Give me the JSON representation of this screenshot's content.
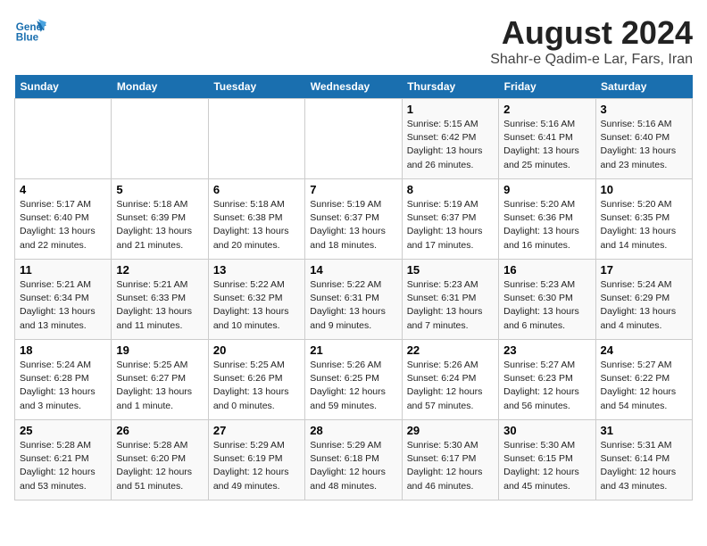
{
  "header": {
    "logo_line1": "General",
    "logo_line2": "Blue",
    "main_title": "August 2024",
    "subtitle": "Shahr-e Qadim-e Lar, Fars, Iran"
  },
  "weekdays": [
    "Sunday",
    "Monday",
    "Tuesday",
    "Wednesday",
    "Thursday",
    "Friday",
    "Saturday"
  ],
  "weeks": [
    [
      {
        "day": "",
        "info": ""
      },
      {
        "day": "",
        "info": ""
      },
      {
        "day": "",
        "info": ""
      },
      {
        "day": "",
        "info": ""
      },
      {
        "day": "1",
        "info": "Sunrise: 5:15 AM\nSunset: 6:42 PM\nDaylight: 13 hours and 26 minutes."
      },
      {
        "day": "2",
        "info": "Sunrise: 5:16 AM\nSunset: 6:41 PM\nDaylight: 13 hours and 25 minutes."
      },
      {
        "day": "3",
        "info": "Sunrise: 5:16 AM\nSunset: 6:40 PM\nDaylight: 13 hours and 23 minutes."
      }
    ],
    [
      {
        "day": "4",
        "info": "Sunrise: 5:17 AM\nSunset: 6:40 PM\nDaylight: 13 hours and 22 minutes."
      },
      {
        "day": "5",
        "info": "Sunrise: 5:18 AM\nSunset: 6:39 PM\nDaylight: 13 hours and 21 minutes."
      },
      {
        "day": "6",
        "info": "Sunrise: 5:18 AM\nSunset: 6:38 PM\nDaylight: 13 hours and 20 minutes."
      },
      {
        "day": "7",
        "info": "Sunrise: 5:19 AM\nSunset: 6:37 PM\nDaylight: 13 hours and 18 minutes."
      },
      {
        "day": "8",
        "info": "Sunrise: 5:19 AM\nSunset: 6:37 PM\nDaylight: 13 hours and 17 minutes."
      },
      {
        "day": "9",
        "info": "Sunrise: 5:20 AM\nSunset: 6:36 PM\nDaylight: 13 hours and 16 minutes."
      },
      {
        "day": "10",
        "info": "Sunrise: 5:20 AM\nSunset: 6:35 PM\nDaylight: 13 hours and 14 minutes."
      }
    ],
    [
      {
        "day": "11",
        "info": "Sunrise: 5:21 AM\nSunset: 6:34 PM\nDaylight: 13 hours and 13 minutes."
      },
      {
        "day": "12",
        "info": "Sunrise: 5:21 AM\nSunset: 6:33 PM\nDaylight: 13 hours and 11 minutes."
      },
      {
        "day": "13",
        "info": "Sunrise: 5:22 AM\nSunset: 6:32 PM\nDaylight: 13 hours and 10 minutes."
      },
      {
        "day": "14",
        "info": "Sunrise: 5:22 AM\nSunset: 6:31 PM\nDaylight: 13 hours and 9 minutes."
      },
      {
        "day": "15",
        "info": "Sunrise: 5:23 AM\nSunset: 6:31 PM\nDaylight: 13 hours and 7 minutes."
      },
      {
        "day": "16",
        "info": "Sunrise: 5:23 AM\nSunset: 6:30 PM\nDaylight: 13 hours and 6 minutes."
      },
      {
        "day": "17",
        "info": "Sunrise: 5:24 AM\nSunset: 6:29 PM\nDaylight: 13 hours and 4 minutes."
      }
    ],
    [
      {
        "day": "18",
        "info": "Sunrise: 5:24 AM\nSunset: 6:28 PM\nDaylight: 13 hours and 3 minutes."
      },
      {
        "day": "19",
        "info": "Sunrise: 5:25 AM\nSunset: 6:27 PM\nDaylight: 13 hours and 1 minute."
      },
      {
        "day": "20",
        "info": "Sunrise: 5:25 AM\nSunset: 6:26 PM\nDaylight: 13 hours and 0 minutes."
      },
      {
        "day": "21",
        "info": "Sunrise: 5:26 AM\nSunset: 6:25 PM\nDaylight: 12 hours and 59 minutes."
      },
      {
        "day": "22",
        "info": "Sunrise: 5:26 AM\nSunset: 6:24 PM\nDaylight: 12 hours and 57 minutes."
      },
      {
        "day": "23",
        "info": "Sunrise: 5:27 AM\nSunset: 6:23 PM\nDaylight: 12 hours and 56 minutes."
      },
      {
        "day": "24",
        "info": "Sunrise: 5:27 AM\nSunset: 6:22 PM\nDaylight: 12 hours and 54 minutes."
      }
    ],
    [
      {
        "day": "25",
        "info": "Sunrise: 5:28 AM\nSunset: 6:21 PM\nDaylight: 12 hours and 53 minutes."
      },
      {
        "day": "26",
        "info": "Sunrise: 5:28 AM\nSunset: 6:20 PM\nDaylight: 12 hours and 51 minutes."
      },
      {
        "day": "27",
        "info": "Sunrise: 5:29 AM\nSunset: 6:19 PM\nDaylight: 12 hours and 49 minutes."
      },
      {
        "day": "28",
        "info": "Sunrise: 5:29 AM\nSunset: 6:18 PM\nDaylight: 12 hours and 48 minutes."
      },
      {
        "day": "29",
        "info": "Sunrise: 5:30 AM\nSunset: 6:17 PM\nDaylight: 12 hours and 46 minutes."
      },
      {
        "day": "30",
        "info": "Sunrise: 5:30 AM\nSunset: 6:15 PM\nDaylight: 12 hours and 45 minutes."
      },
      {
        "day": "31",
        "info": "Sunrise: 5:31 AM\nSunset: 6:14 PM\nDaylight: 12 hours and 43 minutes."
      }
    ]
  ]
}
